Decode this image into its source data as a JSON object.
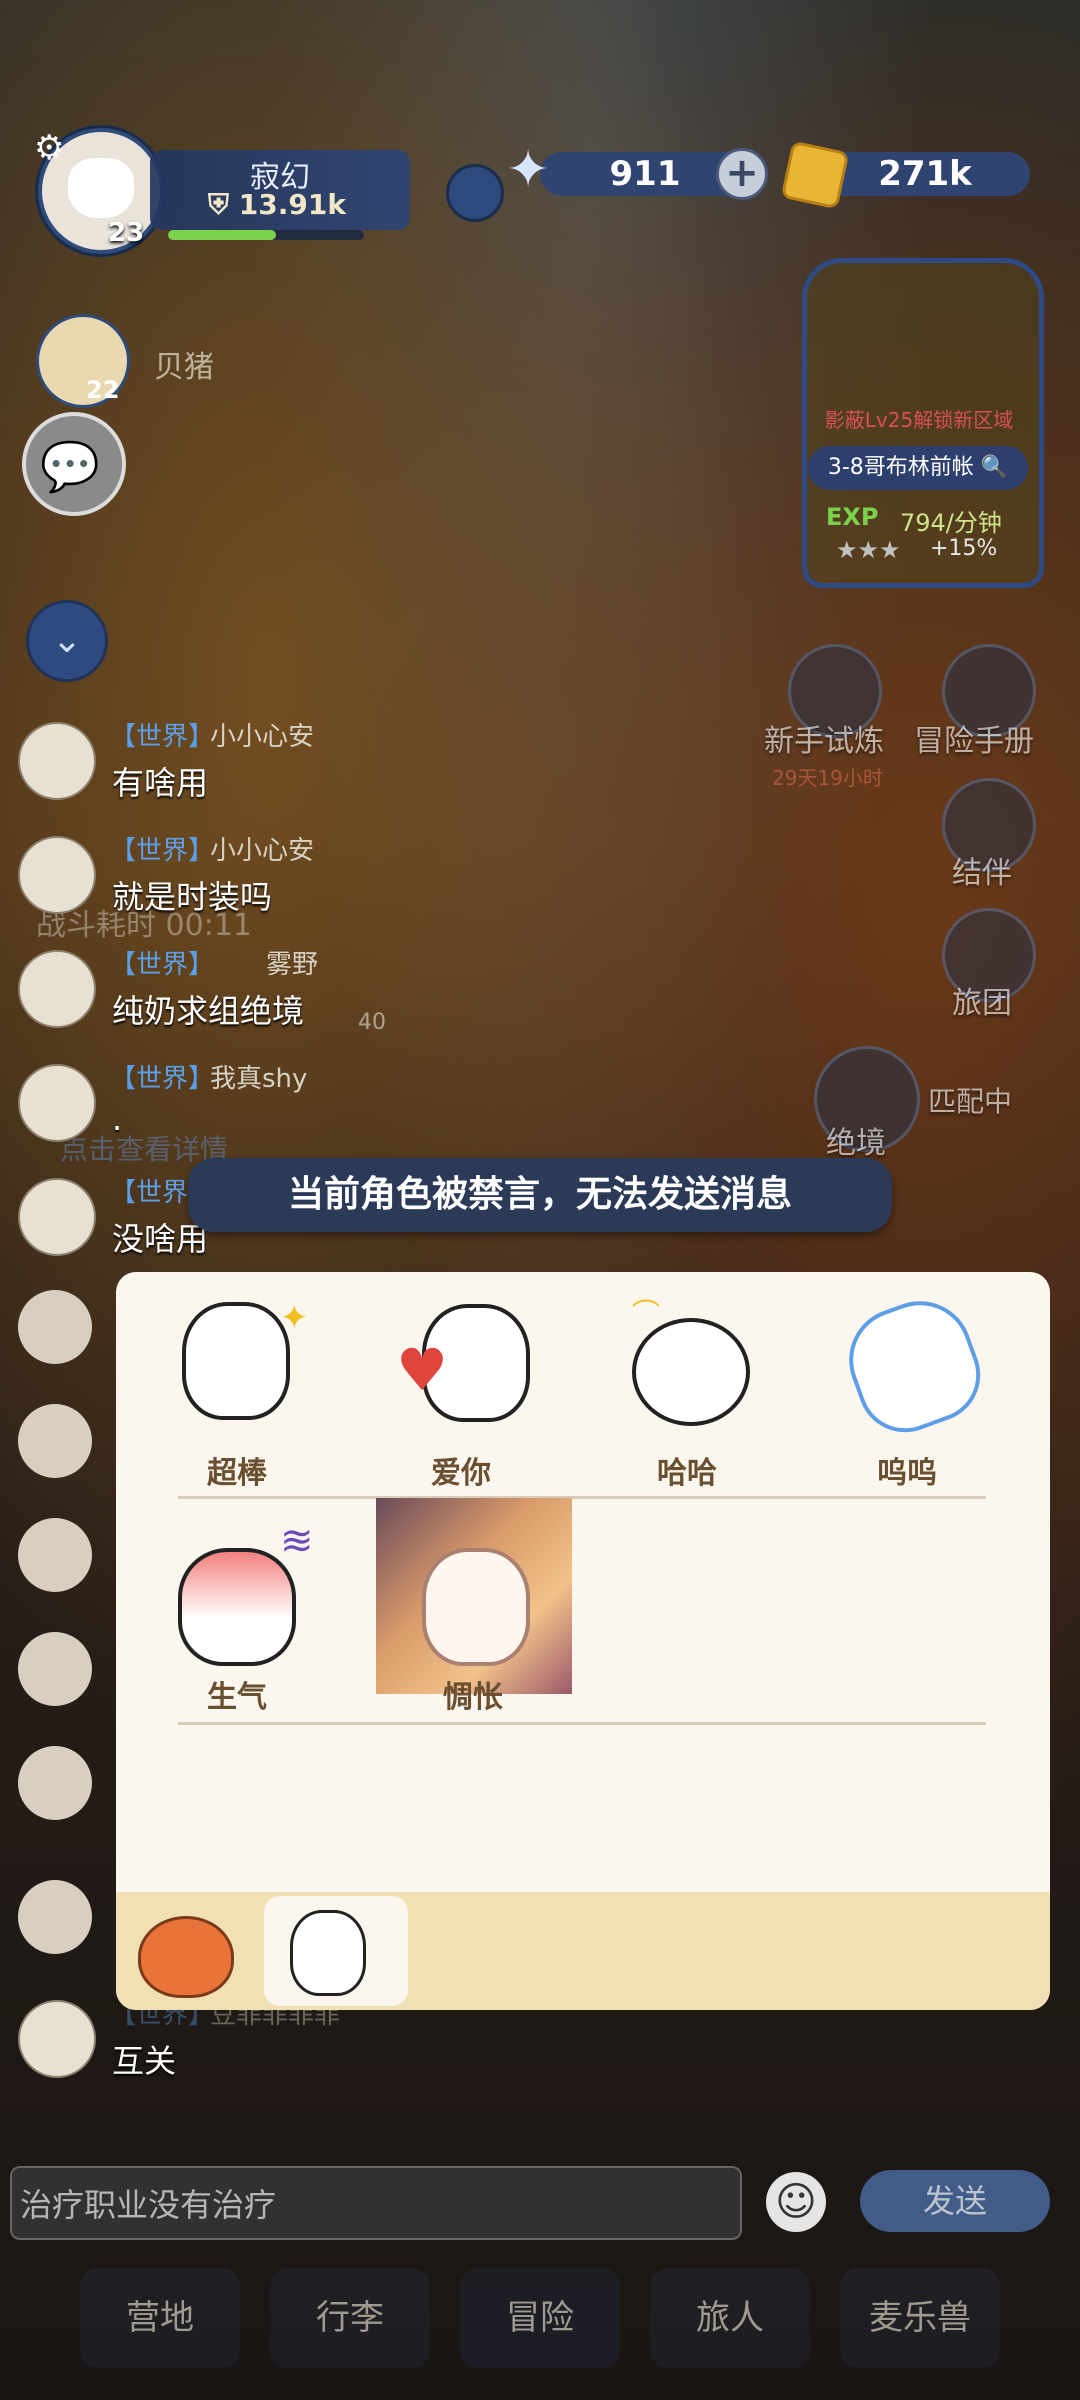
{
  "hud": {
    "player_name": "寂幻",
    "power": "13.91k",
    "level": "23",
    "gems": "911",
    "coins": "271k",
    "plus": "+",
    "companion_level": "22",
    "companion_name": "贝猪"
  },
  "quest": {
    "unlock_text": "影蔽Lv25解锁新区域",
    "stage": "3-8哥布林前帐",
    "exp_label": "EXP",
    "exp_rate": "794/分钟",
    "stars": "★★★",
    "bonus": "+15%"
  },
  "side_menu": {
    "novice_trial": "新手试炼",
    "novice_timer": "29天19小时",
    "adventure_book": "冒险手册",
    "partner": "结伴",
    "travel_group": "旅团",
    "peril": "绝境",
    "matching": "匹配中",
    "battle_time": "战斗耗时 00:11",
    "count_badge": "40",
    "details": "点击查看详情"
  },
  "chat": {
    "messages": [
      {
        "channel": "【世界】",
        "sender": "小小心安",
        "text": "有啥用"
      },
      {
        "channel": "【世界】",
        "sender": "小小心安",
        "text": "就是时装吗"
      },
      {
        "channel": "【世界】",
        "sender": "雾野",
        "text": "纯奶求组绝境"
      },
      {
        "channel": "【世界】",
        "sender": "我真shy",
        "text": "."
      },
      {
        "channel": "【世界】",
        "sender": "",
        "text": "没啥用"
      },
      {
        "channel": "【世界】",
        "sender": "豆菲菲菲菲",
        "text": "互关"
      }
    ]
  },
  "toast": "当前角色被禁言，无法发送消息",
  "emoji_panel": {
    "stickers": [
      {
        "label": "超棒"
      },
      {
        "label": "爱你"
      },
      {
        "label": "哈哈"
      },
      {
        "label": "呜呜"
      },
      {
        "label": "生气"
      },
      {
        "label": "惆怅"
      }
    ]
  },
  "input": {
    "value": "治疗职业没有治疗",
    "send": "发送"
  },
  "nav": {
    "tabs": [
      "营地",
      "行李",
      "冒险",
      "旅人",
      "麦乐兽"
    ]
  }
}
